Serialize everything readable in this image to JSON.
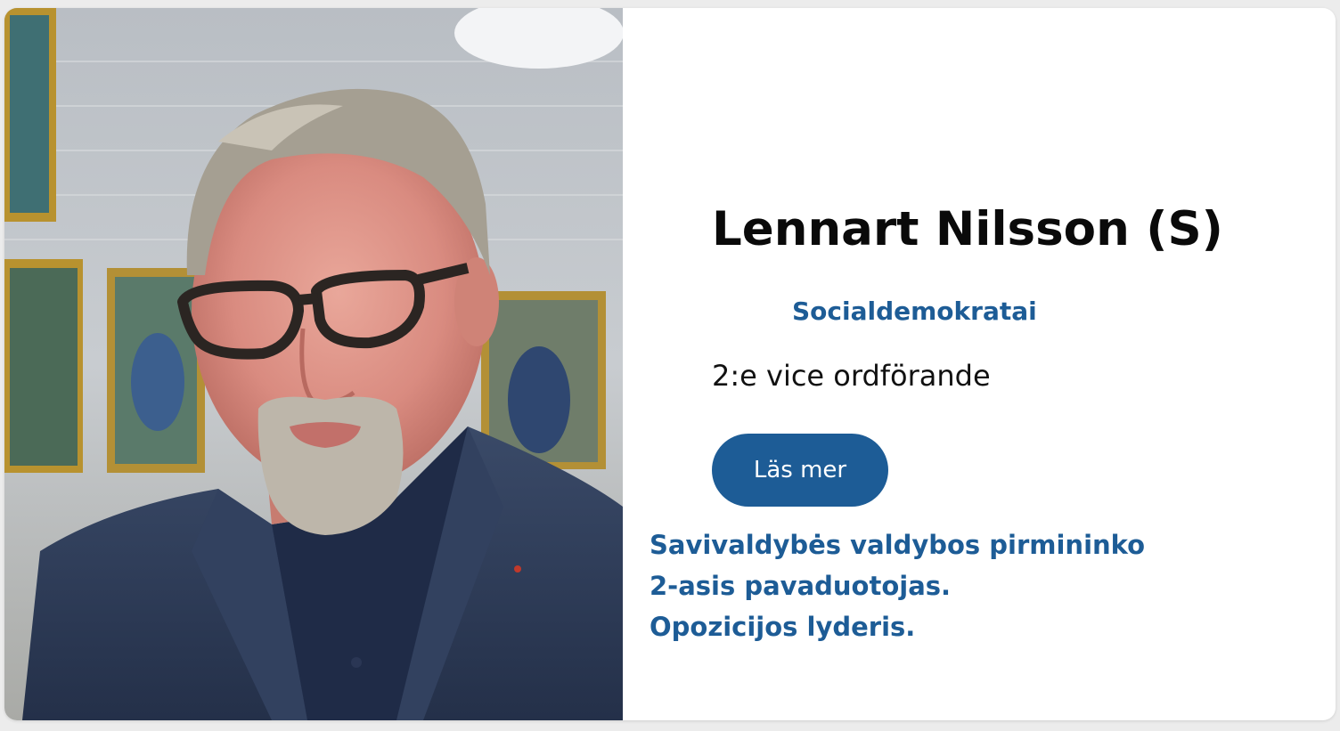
{
  "profile": {
    "photo_alt": "Lennart Nilsson",
    "name": "Lennart Nilsson (S)",
    "party": "Socialdemokratai",
    "role": "2:e vice ordförande",
    "read_more_label": "Läs mer",
    "note_lines": [
      "Savivaldybės valdybos pirmininko",
      "2-asis pavaduotojas.",
      "Opozicijos lyderis."
    ]
  },
  "colors": {
    "accent": "#1d5c96",
    "text": "#0a0a0a",
    "card_background": "#ffffff",
    "page_background": "#ececec"
  }
}
